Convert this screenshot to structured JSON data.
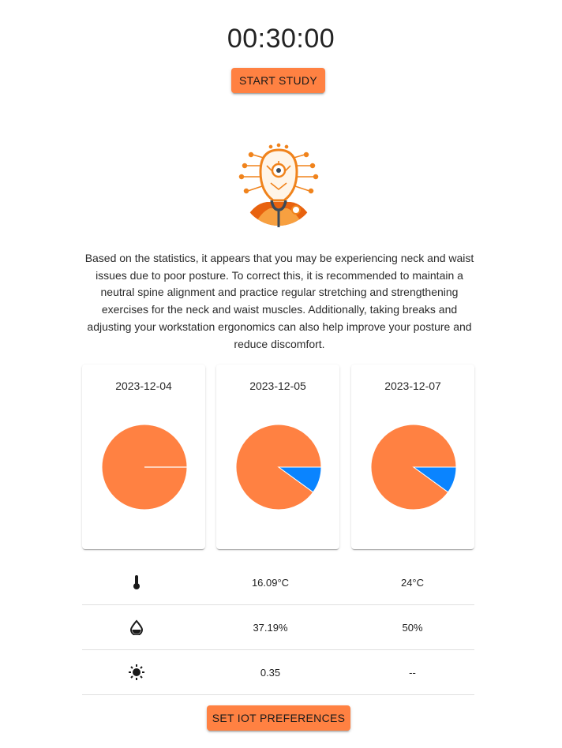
{
  "timer": {
    "display": "00:30:00"
  },
  "controls": {
    "start_label": "START STUDY",
    "iot_label": "SET IOT PREFERENCES"
  },
  "logo": {
    "icon": "posture-head-logo-icon"
  },
  "advice": {
    "text": "Based on the statistics, it appears that you may be experiencing neck and waist issues due to poor posture. To correct this, it is recommended to maintain a neutral spine alignment and practice regular stretching and strengthening exercises for the neck and waist muscles. Additionally, taking breaks and adjusting your workstation ergonomics can also help improve your posture and reduce discomfort."
  },
  "colors": {
    "accent": "#ff8142",
    "good": "#0a84ff"
  },
  "chart_data": [
    {
      "type": "pie",
      "title": "2023-12-04",
      "slices": [
        {
          "color": "#ff8142",
          "value": 1.0
        },
        {
          "color": "#0a84ff",
          "value": 0.0
        }
      ]
    },
    {
      "type": "pie",
      "title": "2023-12-05",
      "slices": [
        {
          "color": "#ff8142",
          "value": 0.9
        },
        {
          "color": "#0a84ff",
          "value": 0.1
        }
      ]
    },
    {
      "type": "pie",
      "title": "2023-12-07",
      "slices": [
        {
          "color": "#ff8142",
          "value": 0.9
        },
        {
          "color": "#0a84ff",
          "value": 0.1
        }
      ]
    }
  ],
  "stats": [
    {
      "icon": "thermometer-icon",
      "value1": "16.09°C",
      "value2": "24°C"
    },
    {
      "icon": "humidity-icon",
      "value1": "37.19%",
      "value2": "50%"
    },
    {
      "icon": "brightness-icon",
      "value1": "0.35",
      "value2": "--"
    }
  ]
}
